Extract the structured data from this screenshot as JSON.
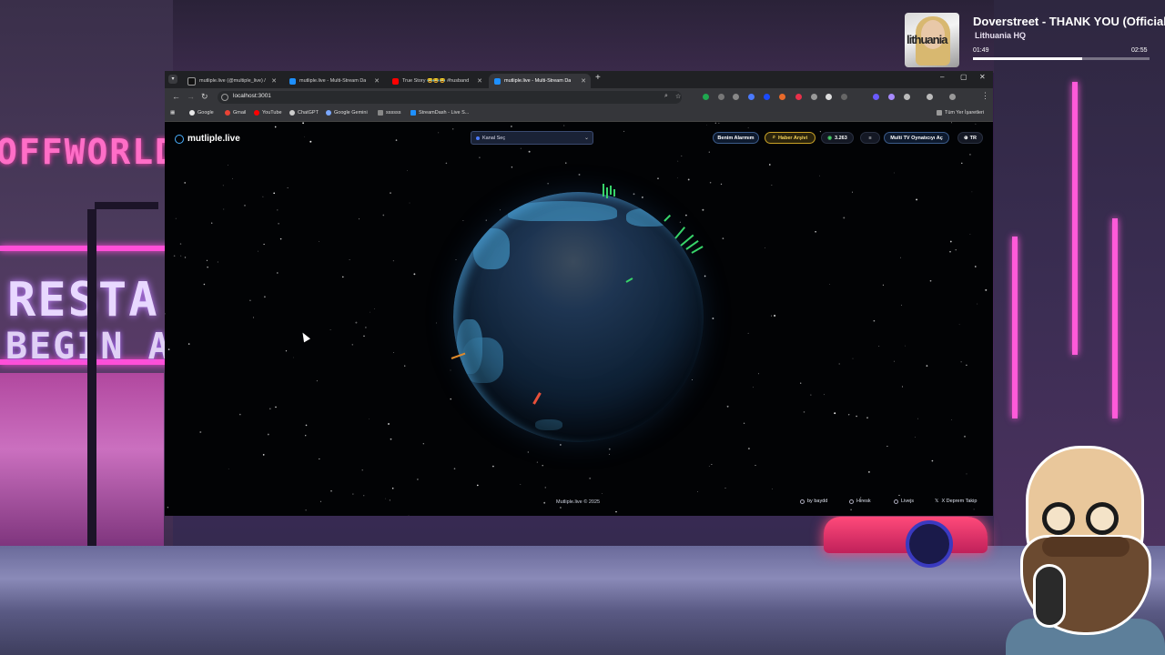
{
  "media": {
    "title": "Doverstreet - THANK YOU (Official",
    "artist": "Lithuania HQ",
    "art_text": "lithuania",
    "elapsed": "01:49",
    "duration": "02:55",
    "progress": 0.62
  },
  "background": {
    "sign_offworld": "OFFWORLD",
    "sign_resta": "RESTA",
    "sign_begin": "BEGIN AG"
  },
  "browser": {
    "tabs": [
      {
        "label": "mutliple.live (@multiple_live) /",
        "favicon": "x-icon",
        "active": false
      },
      {
        "label": "mutliple.live - Multi-Stream Da",
        "favicon": "site-icon",
        "active": false
      },
      {
        "label": "True Story 😂😂😂 #husband",
        "favicon": "youtube-icon",
        "active": false
      },
      {
        "label": "mutliple.live - Multi-Stream Da",
        "favicon": "site-icon",
        "active": true
      }
    ],
    "url": "localhost:3001",
    "bookmarks": [
      {
        "label": "Google",
        "color": "#e8e8e8"
      },
      {
        "label": "Gmail",
        "color": "#ea4335"
      },
      {
        "label": "YouTube",
        "color": "#ff0000"
      },
      {
        "label": "ChatGPT",
        "color": "#cccccc"
      },
      {
        "label": "Google Gemini",
        "color": "#7aa7ff"
      },
      {
        "label": "ssssss",
        "color": "#888888"
      },
      {
        "label": "StreamDash - Live S...",
        "color": "#1e90ff"
      }
    ],
    "all_bookmarks": "Tüm Yer İşaretleri"
  },
  "site": {
    "brand": "mutliple.live",
    "channel_select": "Kanal Seç",
    "buttons": {
      "alarm": "Benim Alarmım",
      "news": "Haber Arşivi",
      "count": "3.263",
      "multi_tv": "Multi TV Oynatıcıyı Aç",
      "lang": "TR"
    },
    "footer": {
      "copyright": "Mutliple.live © 2025",
      "by": "by baydd",
      "hiresk": "Hiresk",
      "livejs": "Livejs",
      "deprem": "X Deprem Takip"
    }
  },
  "colors": {
    "accent_blue": "#3b5b8a",
    "accent_gold": "#c9a227",
    "earth_land": "#3d8bb8",
    "spike_green": "#38d46a"
  }
}
